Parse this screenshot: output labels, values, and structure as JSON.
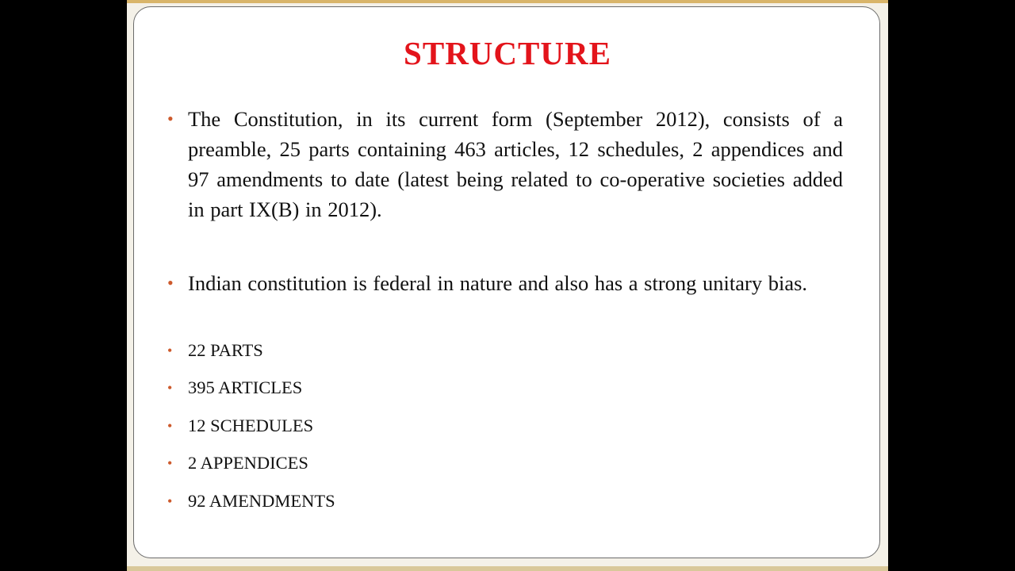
{
  "slide": {
    "title": "STRUCTURE",
    "paragraphs": [
      "The Constitution, in its current form (September 2012), consists of a preamble, 25 parts containing 463 articles, 12 schedules, 2 appendices and 97 amendments to date (latest being related to co-operative societies added in part IX(B) in 2012).",
      "Indian constitution is federal in nature and also has a strong unitary bias."
    ],
    "items": [
      "22 PARTS",
      "395 ARTICLES",
      "12 SCHEDULES",
      "2 APPENDICES",
      "92 AMENDMENTS"
    ],
    "bullet_glyph": "•",
    "colors": {
      "title": "#e3141b",
      "bullet": "#cd5a2c",
      "text": "#111111",
      "panel_border": "#6b6b6b"
    }
  }
}
